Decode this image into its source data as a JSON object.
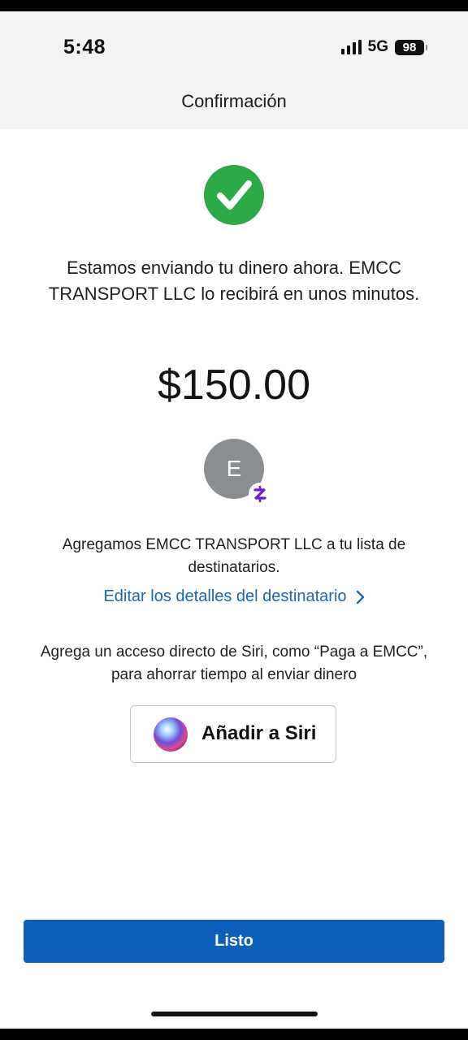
{
  "status_bar": {
    "time": "5:48",
    "network": "5G",
    "battery": "98"
  },
  "header": {
    "title": "Confirmación"
  },
  "confirmation": {
    "icon": "check-circle-icon",
    "message": "Estamos enviando tu dinero ahora. EMCC TRANSPORT LLC lo recibirá en unos minutos.",
    "amount": "$150.00",
    "success_color": "#2aab47"
  },
  "recipient": {
    "avatar_initial": "E",
    "badge_icon": "zelle-icon",
    "badge_color": "#6d1ed4",
    "added_text": "Agregamos EMCC TRANSPORT LLC a tu lista de destinatarios.",
    "edit_link": "Editar los detalles del destinatario"
  },
  "siri": {
    "description": "Agrega un acceso directo de Siri, como “Paga a EMCC”, para ahorrar tiempo al enviar dinero",
    "button_label": "Añadir a Siri"
  },
  "footer": {
    "done_label": "Listo",
    "accent_color": "#0d5fbb"
  }
}
